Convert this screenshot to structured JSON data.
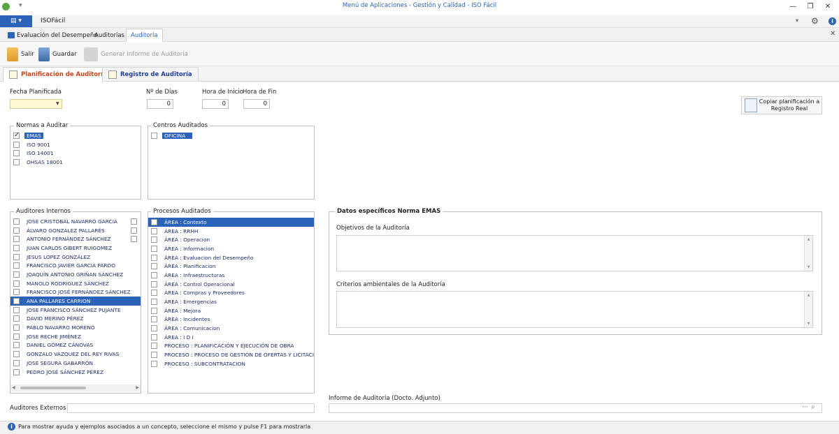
{
  "window": {
    "title": "Menú de Aplicaciones - Gestión y Calidad - ISO Fácil",
    "app_menu_label": "▤ ▾",
    "ribbon_title": "ISOFácil"
  },
  "main_tabs": [
    {
      "label": "Evaluación del Desempeño",
      "active": false
    },
    {
      "label": "Auditorías",
      "active": false
    },
    {
      "label": "Auditoría",
      "active": true
    }
  ],
  "toolbar": {
    "salir": "Salir",
    "guardar": "Guardar",
    "generar": "Generar Informe de Auditoría"
  },
  "sub_tabs": [
    {
      "label": "Planificación de Auditoría",
      "active": true
    },
    {
      "label": "Registro de Auditoría",
      "active": false
    }
  ],
  "form": {
    "fecha_label": "Fecha Planificada",
    "fecha_value": "",
    "dias_label": "Nº de Días",
    "dias_value": "0",
    "hora_inicio_label": "Hora de Inicio",
    "hora_inicio_value": "0",
    "hora_fin_label": "Hora de Fin",
    "hora_fin_value": "0",
    "copy_button": "Copiar planificación a Registro Real"
  },
  "normas": {
    "title": "Normas a Auditar",
    "items": [
      {
        "label": "EMAS",
        "checked": true,
        "selected": true
      },
      {
        "label": "ISO 9001",
        "checked": false,
        "selected": false
      },
      {
        "label": "ISO 14001",
        "checked": false,
        "selected": false
      },
      {
        "label": "OHSAS 18001",
        "checked": false,
        "selected": false
      }
    ]
  },
  "centros": {
    "title": "Centros Auditados",
    "items": [
      {
        "label": "OFICINA",
        "checked": false,
        "selected": true
      }
    ]
  },
  "auditores": {
    "title": "Auditores Internos",
    "items": [
      {
        "label": "JOSE CRISTOBAL NAVARRO GARCIA",
        "selected": false
      },
      {
        "label": "ÁLVARO GONZÁLEZ PALLARÉS",
        "selected": false
      },
      {
        "label": "ANTONIO FERNÁNDEZ SÁNCHEZ",
        "selected": false
      },
      {
        "label": "JUAN CARLOS GIBERT RUIGOMEZ",
        "selected": false
      },
      {
        "label": "JESUS LOPEZ GONZÁLEZ",
        "selected": false
      },
      {
        "label": "FRANCISCO JAVIER GARCIA PARDO",
        "selected": false
      },
      {
        "label": "JOAQUÍN ANTONIO GRIÑAN SÁNCHEZ",
        "selected": false
      },
      {
        "label": "MANOLO RODRÍGUEZ SÁNCHEZ",
        "selected": false
      },
      {
        "label": "FRANCISCO JOSÉ FERNÁNDEZ SÁNCHEZ",
        "selected": false
      },
      {
        "label": "ANA PALLARES CARRION",
        "selected": true
      },
      {
        "label": "JOSE FRANCISCO SÁNCHEZ PUJANTE",
        "selected": false
      },
      {
        "label": "DAVID MERINO PÉREZ",
        "selected": false
      },
      {
        "label": "PABLO NAVARRO MORENO",
        "selected": false
      },
      {
        "label": "JOSE RECHE JIMÉNEZ",
        "selected": false
      },
      {
        "label": "DANIEL GÓMEZ CÁNOVAS",
        "selected": false
      },
      {
        "label": "GONZALO VAZQUEZ DEL REY RIVAS",
        "selected": false
      },
      {
        "label": "JOSE SEGURA GABARRÓN",
        "selected": false
      },
      {
        "label": "PEDRO JOSÉ SÁNCHEZ PÉREZ",
        "selected": false
      }
    ]
  },
  "procesos": {
    "title": "Procesos Auditados",
    "items": [
      {
        "label": "ÁREA : Contexto",
        "selected": true
      },
      {
        "label": "ÁREA : RRHH",
        "selected": false
      },
      {
        "label": "ÁREA : Operacion",
        "selected": false
      },
      {
        "label": "ÁREA : Informacion",
        "selected": false
      },
      {
        "label": "ÁREA : Evaluacion del Desempeño",
        "selected": false
      },
      {
        "label": "ÁREA : Planificacion",
        "selected": false
      },
      {
        "label": "ÁREA : Infraestructuras",
        "selected": false
      },
      {
        "label": "ÁREA : Control Operacional",
        "selected": false
      },
      {
        "label": "ÁREA : Compras y Proveedores",
        "selected": false
      },
      {
        "label": "ÁREA : Emergencias",
        "selected": false
      },
      {
        "label": "ÁREA : Mejora",
        "selected": false
      },
      {
        "label": "ÁREA : Incidentes",
        "selected": false
      },
      {
        "label": "ÁREA : Comunicacion",
        "selected": false
      },
      {
        "label": "ÁREA : I D I",
        "selected": false
      },
      {
        "label": "PROCESO : PLANIFICACIÓN Y EJECUCIÓN DE OBRA",
        "selected": false
      },
      {
        "label": "PROCESO : PROCESO DE GESTIÓN DE OFERTAS Y LICITACIONES",
        "selected": false
      },
      {
        "label": "PROCESO : SUBCONTRATACION",
        "selected": false
      }
    ]
  },
  "datos": {
    "title": "Datos específicos Norma EMAS",
    "objetivos_label": "Objetivos de la Auditoría",
    "objetivos_value": "",
    "criterios_label": "Criterios ambientales de la Auditoría",
    "criterios_value": ""
  },
  "externos": {
    "label": "Auditores Externos",
    "value": ""
  },
  "informe": {
    "label": "Informe de Auditoría (Docto. Adjunto)",
    "value": ""
  },
  "status": {
    "text": "Para mostrar ayuda y ejemplos asociados a un concepto, seleccione el mismo y pulse F1 para mostrarla"
  }
}
